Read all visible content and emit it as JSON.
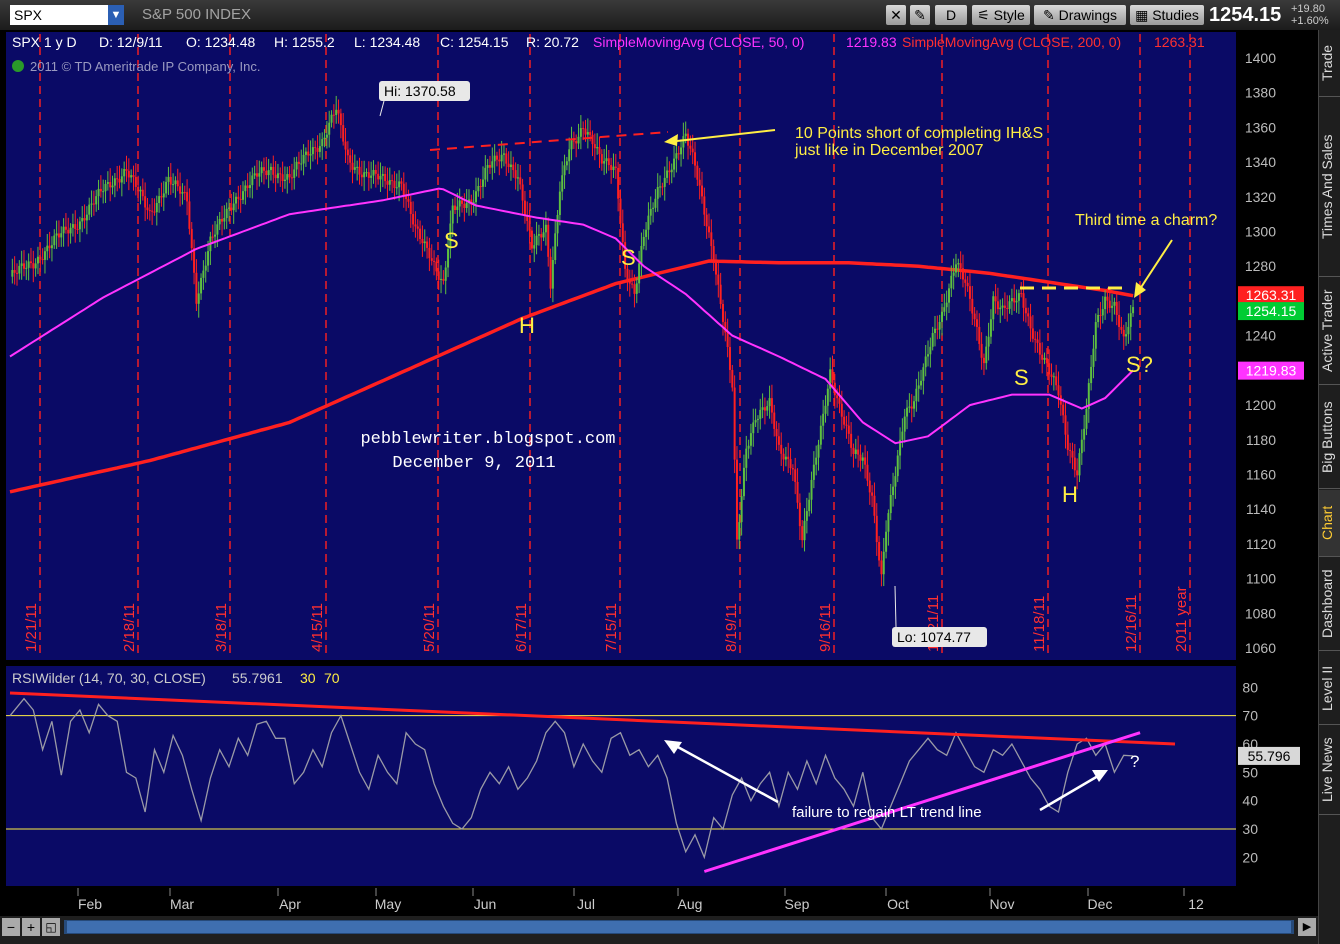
{
  "toolbar": {
    "symbol": "SPX",
    "index_name": "S&P 500 INDEX",
    "d_button": "D",
    "style_label": "Style",
    "drawings_label": "Drawings",
    "studies_label": "Studies",
    "last_price": "1254.15",
    "change_points": "+19.80",
    "change_pct": "+1.60%"
  },
  "side_tabs": [
    "Trade",
    "Times And Sales",
    "Active Trader",
    "Big Buttons",
    "Chart",
    "Dashboard",
    "Level II",
    "Live News"
  ],
  "header": {
    "period": "SPX 1 y D",
    "date": "D: 12/9/11",
    "open": "O: 1234.48",
    "high": "H: 1255.2",
    "low": "L: 1234.48",
    "close": "C: 1254.15",
    "range": "R: 20.72",
    "sma50_label": "SimpleMovingAvg (CLOSE, 50, 0)",
    "sma50_value": "1219.83",
    "sma200_label": "SimpleMovingAvg (CLOSE, 200, 0)",
    "sma200_value": "1263.31",
    "copyright": "2011 © TD Ameritrade IP Company, Inc."
  },
  "rsi_header": {
    "label": "RSIWilder (14, 70, 30, CLOSE)",
    "value": "55.7961",
    "low": "30",
    "high": "70"
  },
  "watermark": {
    "line1": "pebblewriter.blogspot.com",
    "line2": "December 9, 2011"
  },
  "colors": {
    "background": "#0a0a66",
    "up_candle": "#5ec040",
    "down_candle": "#ff2020",
    "sma50": "#ff33ff",
    "sma200": "#ff2020",
    "annotation": "#ffee44",
    "grid_line": "#ff2020"
  },
  "chart_data": [
    {
      "type": "candlestick",
      "ylim": [
        1060,
        1400
      ],
      "y_ticks": [
        1060,
        1080,
        1100,
        1120,
        1140,
        1160,
        1180,
        1200,
        1220,
        1240,
        1260,
        1280,
        1300,
        1320,
        1340,
        1360,
        1380,
        1400
      ],
      "x_ticks": [
        "Feb",
        "Mar",
        "Apr",
        "May",
        "Jun",
        "Jul",
        "Aug",
        "Sep",
        "Oct",
        "Nov",
        "Dec",
        "12"
      ],
      "week_markers": [
        "1/21/11",
        "2/18/11",
        "3/18/11",
        "4/15/11",
        "5/20/11",
        "6/17/11",
        "7/15/11",
        "8/19/11",
        "9/16/11",
        "10/21/11",
        "11/18/11",
        "12/16/11",
        "2011 year"
      ],
      "close_path": [
        [
          0,
          1274
        ],
        [
          10,
          1282
        ],
        [
          20,
          1296
        ],
        [
          30,
          1306
        ],
        [
          40,
          1324
        ],
        [
          50,
          1336
        ],
        [
          60,
          1310
        ],
        [
          68,
          1330
        ],
        [
          76,
          1318
        ],
        [
          80,
          1262
        ],
        [
          86,
          1294
        ],
        [
          96,
          1318
        ],
        [
          106,
          1332
        ],
        [
          112,
          1336
        ],
        [
          120,
          1330
        ],
        [
          128,
          1346
        ],
        [
          134,
          1352
        ],
        [
          140,
          1370
        ],
        [
          145,
          1342
        ],
        [
          152,
          1333
        ],
        [
          160,
          1330
        ],
        [
          168,
          1328
        ],
        [
          174,
          1300
        ],
        [
          180,
          1288
        ],
        [
          186,
          1270
        ],
        [
          190,
          1312
        ],
        [
          198,
          1318
        ],
        [
          205,
          1337
        ],
        [
          212,
          1343
        ],
        [
          218,
          1333
        ],
        [
          224,
          1290
        ],
        [
          230,
          1302
        ],
        [
          232,
          1271
        ],
        [
          236,
          1326
        ],
        [
          240,
          1347
        ],
        [
          244,
          1353
        ],
        [
          246,
          1360
        ],
        [
          250,
          1354
        ],
        [
          254,
          1342
        ],
        [
          260,
          1333
        ],
        [
          264,
          1278
        ],
        [
          268,
          1266
        ],
        [
          272,
          1298
        ],
        [
          278,
          1322
        ],
        [
          282,
          1334
        ],
        [
          286,
          1345
        ],
        [
          290,
          1355
        ],
        [
          294,
          1337
        ],
        [
          298,
          1312
        ],
        [
          302,
          1286
        ],
        [
          306,
          1250
        ],
        [
          310,
          1210
        ],
        [
          312,
          1120
        ],
        [
          316,
          1176
        ],
        [
          320,
          1194
        ],
        [
          326,
          1200
        ],
        [
          330,
          1174
        ],
        [
          336,
          1166
        ],
        [
          340,
          1122
        ],
        [
          344,
          1154
        ],
        [
          348,
          1186
        ],
        [
          352,
          1220
        ],
        [
          356,
          1199
        ],
        [
          362,
          1171
        ],
        [
          366,
          1170
        ],
        [
          370,
          1148
        ],
        [
          374,
          1100
        ],
        [
          376,
          1128
        ],
        [
          380,
          1160
        ],
        [
          384,
          1196
        ],
        [
          388,
          1204
        ],
        [
          392,
          1220
        ],
        [
          396,
          1238
        ],
        [
          400,
          1252
        ],
        [
          404,
          1274
        ],
        [
          406,
          1284
        ],
        [
          410,
          1270
        ],
        [
          414,
          1248
        ],
        [
          418,
          1224
        ],
        [
          422,
          1262
        ],
        [
          426,
          1254
        ],
        [
          430,
          1258
        ],
        [
          434,
          1264
        ],
        [
          438,
          1246
        ],
        [
          442,
          1230
        ],
        [
          446,
          1218
        ],
        [
          450,
          1208
        ],
        [
          454,
          1178
        ],
        [
          458,
          1161
        ],
        [
          462,
          1196
        ],
        [
          466,
          1246
        ],
        [
          470,
          1262
        ],
        [
          474,
          1258
        ],
        [
          478,
          1236
        ],
        [
          482,
          1254
        ]
      ],
      "sma50_path": [
        [
          0,
          1228
        ],
        [
          40,
          1262
        ],
        [
          80,
          1290
        ],
        [
          120,
          1310
        ],
        [
          160,
          1318
        ],
        [
          185,
          1325
        ],
        [
          200,
          1315
        ],
        [
          226,
          1308
        ],
        [
          246,
          1304
        ],
        [
          260,
          1296
        ],
        [
          272,
          1280
        ],
        [
          290,
          1264
        ],
        [
          310,
          1240
        ],
        [
          330,
          1228
        ],
        [
          350,
          1215
        ],
        [
          366,
          1190
        ],
        [
          380,
          1178
        ],
        [
          394,
          1182
        ],
        [
          412,
          1200
        ],
        [
          430,
          1206
        ],
        [
          446,
          1206
        ],
        [
          460,
          1198
        ],
        [
          470,
          1204
        ],
        [
          482,
          1220
        ]
      ],
      "sma200_path": [
        [
          0,
          1150
        ],
        [
          60,
          1168
        ],
        [
          120,
          1190
        ],
        [
          180,
          1226
        ],
        [
          220,
          1250
        ],
        [
          260,
          1270
        ],
        [
          300,
          1283
        ],
        [
          330,
          1282
        ],
        [
          360,
          1282
        ],
        [
          390,
          1280
        ],
        [
          420,
          1276
        ],
        [
          450,
          1270
        ],
        [
          470,
          1266
        ],
        [
          482,
          1263
        ]
      ],
      "hi_label": "Hi: 1370.58",
      "lo_label": "Lo: 1074.77",
      "price_labels": [
        {
          "text": "1263.31",
          "value": 1263.31,
          "color": "#ff2020"
        },
        {
          "text": "1254.15",
          "value": 1254.15,
          "color": "#00cc33"
        },
        {
          "text": "1219.83",
          "value": 1219.83,
          "color": "#ff33ff"
        }
      ],
      "annotations": [
        {
          "text": "10 Points short of completing IH&S"
        },
        {
          "text": "just like in December 2007"
        },
        {
          "text": "Third time a charm?"
        },
        {
          "text": "S"
        },
        {
          "text": "H"
        },
        {
          "text": "S"
        },
        {
          "text": "S"
        },
        {
          "text": "H"
        },
        {
          "text": "S?"
        }
      ]
    },
    {
      "type": "line",
      "ylim": [
        12,
        84
      ],
      "y_ticks": [
        20,
        30,
        40,
        50,
        60,
        70,
        80
      ],
      "current_label": "55.796",
      "rsi_path": [
        [
          0,
          70
        ],
        [
          6,
          76
        ],
        [
          10,
          72
        ],
        [
          14,
          58
        ],
        [
          18,
          68
        ],
        [
          22,
          49
        ],
        [
          26,
          68
        ],
        [
          30,
          72
        ],
        [
          34,
          64
        ],
        [
          38,
          74
        ],
        [
          42,
          70
        ],
        [
          46,
          68
        ],
        [
          50,
          50
        ],
        [
          54,
          48
        ],
        [
          58,
          36
        ],
        [
          62,
          58
        ],
        [
          66,
          50
        ],
        [
          70,
          63
        ],
        [
          74,
          56
        ],
        [
          78,
          44
        ],
        [
          82,
          33
        ],
        [
          86,
          48
        ],
        [
          90,
          58
        ],
        [
          94,
          52
        ],
        [
          98,
          62
        ],
        [
          102,
          56
        ],
        [
          106,
          67
        ],
        [
          110,
          68
        ],
        [
          114,
          62
        ],
        [
          118,
          62
        ],
        [
          122,
          46
        ],
        [
          126,
          50
        ],
        [
          130,
          58
        ],
        [
          134,
          52
        ],
        [
          138,
          64
        ],
        [
          142,
          70
        ],
        [
          146,
          60
        ],
        [
          150,
          50
        ],
        [
          154,
          44
        ],
        [
          158,
          56
        ],
        [
          162,
          50
        ],
        [
          166,
          46
        ],
        [
          170,
          64
        ],
        [
          174,
          60
        ],
        [
          178,
          58
        ],
        [
          182,
          46
        ],
        [
          186,
          38
        ],
        [
          190,
          32
        ],
        [
          194,
          30
        ],
        [
          198,
          34
        ],
        [
          202,
          44
        ],
        [
          206,
          50
        ],
        [
          210,
          46
        ],
        [
          214,
          52
        ],
        [
          218,
          44
        ],
        [
          222,
          48
        ],
        [
          226,
          54
        ],
        [
          230,
          64
        ],
        [
          234,
          68
        ],
        [
          238,
          64
        ],
        [
          242,
          52
        ],
        [
          246,
          60
        ],
        [
          250,
          54
        ],
        [
          254,
          50
        ],
        [
          258,
          62
        ],
        [
          262,
          64
        ],
        [
          266,
          56
        ],
        [
          270,
          58
        ],
        [
          274,
          52
        ],
        [
          278,
          56
        ],
        [
          282,
          48
        ],
        [
          286,
          32
        ],
        [
          290,
          22
        ],
        [
          294,
          28
        ],
        [
          298,
          20
        ],
        [
          302,
          34
        ],
        [
          306,
          30
        ],
        [
          310,
          42
        ],
        [
          314,
          48
        ],
        [
          318,
          40
        ],
        [
          322,
          46
        ],
        [
          326,
          50
        ],
        [
          330,
          38
        ],
        [
          334,
          50
        ],
        [
          338,
          44
        ],
        [
          342,
          54
        ],
        [
          346,
          46
        ],
        [
          350,
          56
        ],
        [
          354,
          48
        ],
        [
          358,
          44
        ],
        [
          362,
          38
        ],
        [
          366,
          50
        ],
        [
          370,
          34
        ],
        [
          374,
          30
        ],
        [
          378,
          38
        ],
        [
          382,
          46
        ],
        [
          386,
          54
        ],
        [
          390,
          58
        ],
        [
          394,
          62
        ],
        [
          398,
          58
        ],
        [
          402,
          56
        ],
        [
          406,
          64
        ],
        [
          410,
          58
        ],
        [
          414,
          52
        ],
        [
          418,
          50
        ],
        [
          422,
          58
        ],
        [
          426,
          56
        ],
        [
          430,
          60
        ],
        [
          434,
          54
        ],
        [
          438,
          48
        ],
        [
          442,
          44
        ],
        [
          446,
          38
        ],
        [
          450,
          36
        ],
        [
          454,
          50
        ],
        [
          458,
          60
        ],
        [
          462,
          62
        ],
        [
          466,
          56
        ],
        [
          470,
          60
        ],
        [
          474,
          50
        ],
        [
          478,
          56
        ],
        [
          482,
          55.8
        ]
      ],
      "trend_lines": [
        {
          "from": [
            0,
            78
          ],
          "to": [
            500,
            60
          ],
          "color": "#ff2020"
        },
        {
          "from": [
            298,
            15
          ],
          "to": [
            485,
            64
          ],
          "color": "#ff33ff"
        }
      ],
      "annotations": [
        {
          "text": "failure to regain LT trend line"
        },
        {
          "text": "?"
        }
      ]
    }
  ]
}
